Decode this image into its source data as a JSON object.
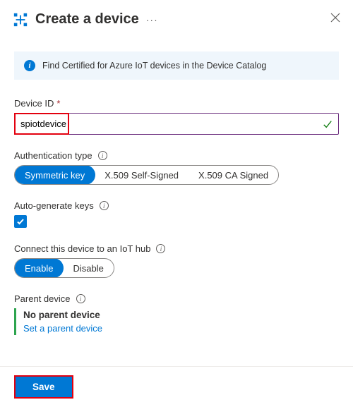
{
  "header": {
    "title": "Create a device",
    "more": "···"
  },
  "infoBar": {
    "text": "Find Certified for Azure IoT devices in the Device Catalog"
  },
  "deviceId": {
    "label": "Device ID",
    "value": "spiotdevice"
  },
  "authType": {
    "label": "Authentication type",
    "options": [
      "Symmetric key",
      "X.509 Self-Signed",
      "X.509 CA Signed"
    ],
    "selectedIndex": 0
  },
  "autoGen": {
    "label": "Auto-generate keys",
    "checked": true
  },
  "connectHub": {
    "label": "Connect this device to an IoT hub",
    "options": [
      "Enable",
      "Disable"
    ],
    "selectedIndex": 0
  },
  "parentDevice": {
    "label": "Parent device",
    "status": "No parent device",
    "linkText": "Set a parent device"
  },
  "footer": {
    "save": "Save"
  }
}
